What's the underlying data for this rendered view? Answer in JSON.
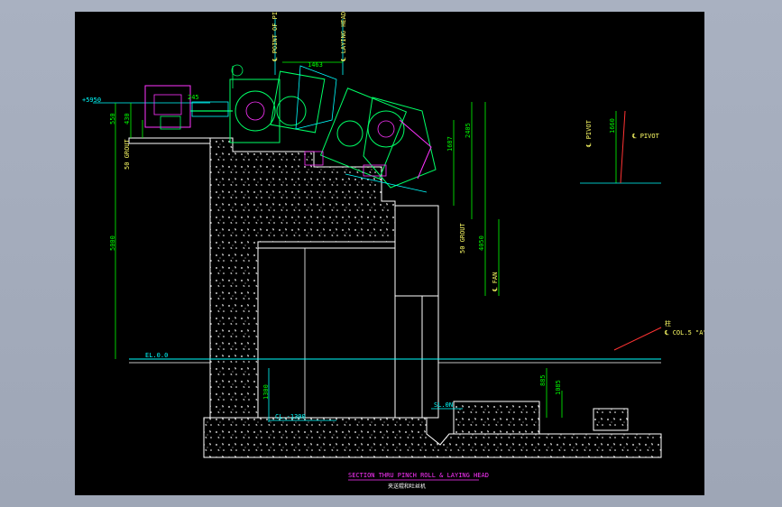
{
  "drawing": {
    "title": "SECTION THRU PINCH ROLL & LAYING HEAD",
    "subtitle": "夹送辊和吐丝机",
    "colors": {
      "background": "#000000",
      "frame": "#a4acbc",
      "concrete": "#ffffff",
      "dimension": "#00ff00",
      "reference": "#00ffff",
      "machine_green": "#00ff66",
      "machine_magenta": "#ff33ff",
      "title": "#ff33ff",
      "annotation": "#ffff66",
      "leader": "#ff3333"
    },
    "top_labels": {
      "point_of_pinch_roll": "℄ POINT OF PINCH ROLL",
      "laying_head": "℄ LAYING HEAD",
      "offset": "1463"
    },
    "elevations": {
      "top": "+5950",
      "el_zero": "EL.0.0",
      "cl_bottom": "CL.-1300",
      "sl": "SL.0N"
    },
    "left_dims": {
      "d550": "550",
      "d430": "430",
      "d5000": "5000",
      "grout": "50 GROUT",
      "d245": "245",
      "d1300": "1300"
    },
    "right_dims": {
      "d1687": "1687",
      "d2405": "2405",
      "d4050": "4050",
      "grout": "50 GROUT",
      "fan": "℄ FAN",
      "d885": "885",
      "d1085": "1085"
    },
    "pivot": {
      "label_a": "℄ PIVOT",
      "label_b": "℄ PIVOT",
      "dim": "1660"
    },
    "column_note": "℄ COL.5 \"A\"",
    "column_note_cn": "柱"
  }
}
